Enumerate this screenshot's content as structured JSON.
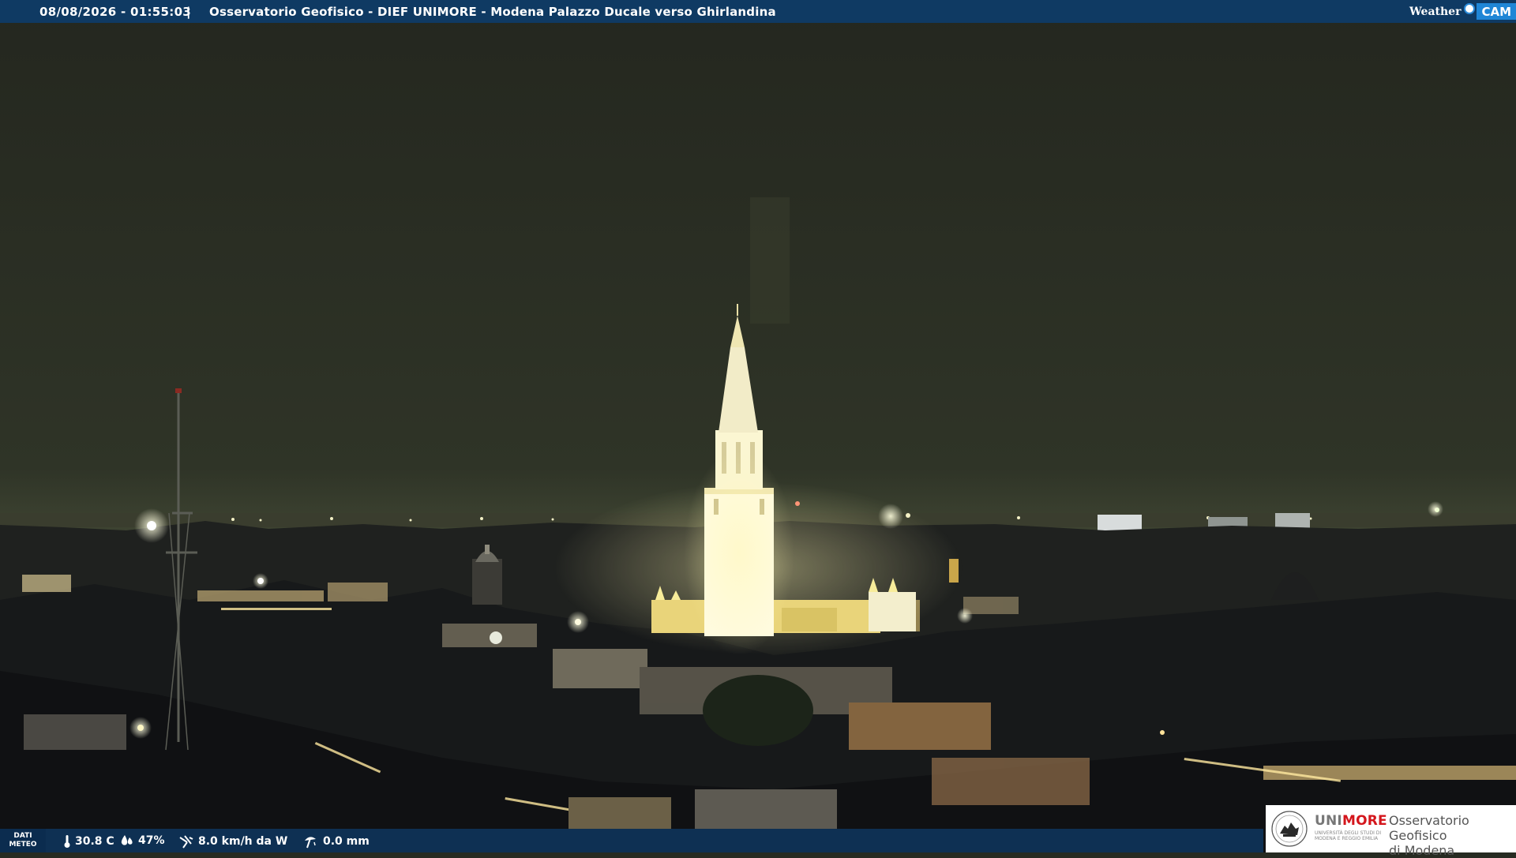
{
  "top_banner": {
    "datetime": "08/08/2026 - 01:55:03",
    "separator": "|",
    "caption": "Osservatorio Geofisico - DIEF UNIMORE - Modena Palazzo Ducale verso Ghirlandina"
  },
  "brand_logo": {
    "weather": "Weather",
    "cam": "CAM"
  },
  "weather_strip": {
    "label_line1": "DATI",
    "label_line2": "METEO",
    "temperature": "30.8 C",
    "humidity": "47%",
    "wind": "8.0 km/h da W",
    "rain": "0.0 mm",
    "icons": [
      "thermometer-icon",
      "humidity-drop-icon",
      "wind-icon",
      "rain-gauge-icon"
    ]
  },
  "institution_logo": {
    "name_gray": "UNI",
    "name_red": "MORE",
    "subtitle_line1": "UNIVERSITÀ DEGLI STUDI DI",
    "subtitle_line2": "MODENA E REGGIO EMILIA",
    "observatory_line1": "Osservatorio Geofisico",
    "observatory_line2": "di Modena",
    "colors": {
      "red": "#d4161c",
      "gray": "#777777"
    }
  },
  "colors": {
    "banner": "#0f3a63",
    "sky": "#2e3226",
    "tower_light": "#fff6c8"
  }
}
